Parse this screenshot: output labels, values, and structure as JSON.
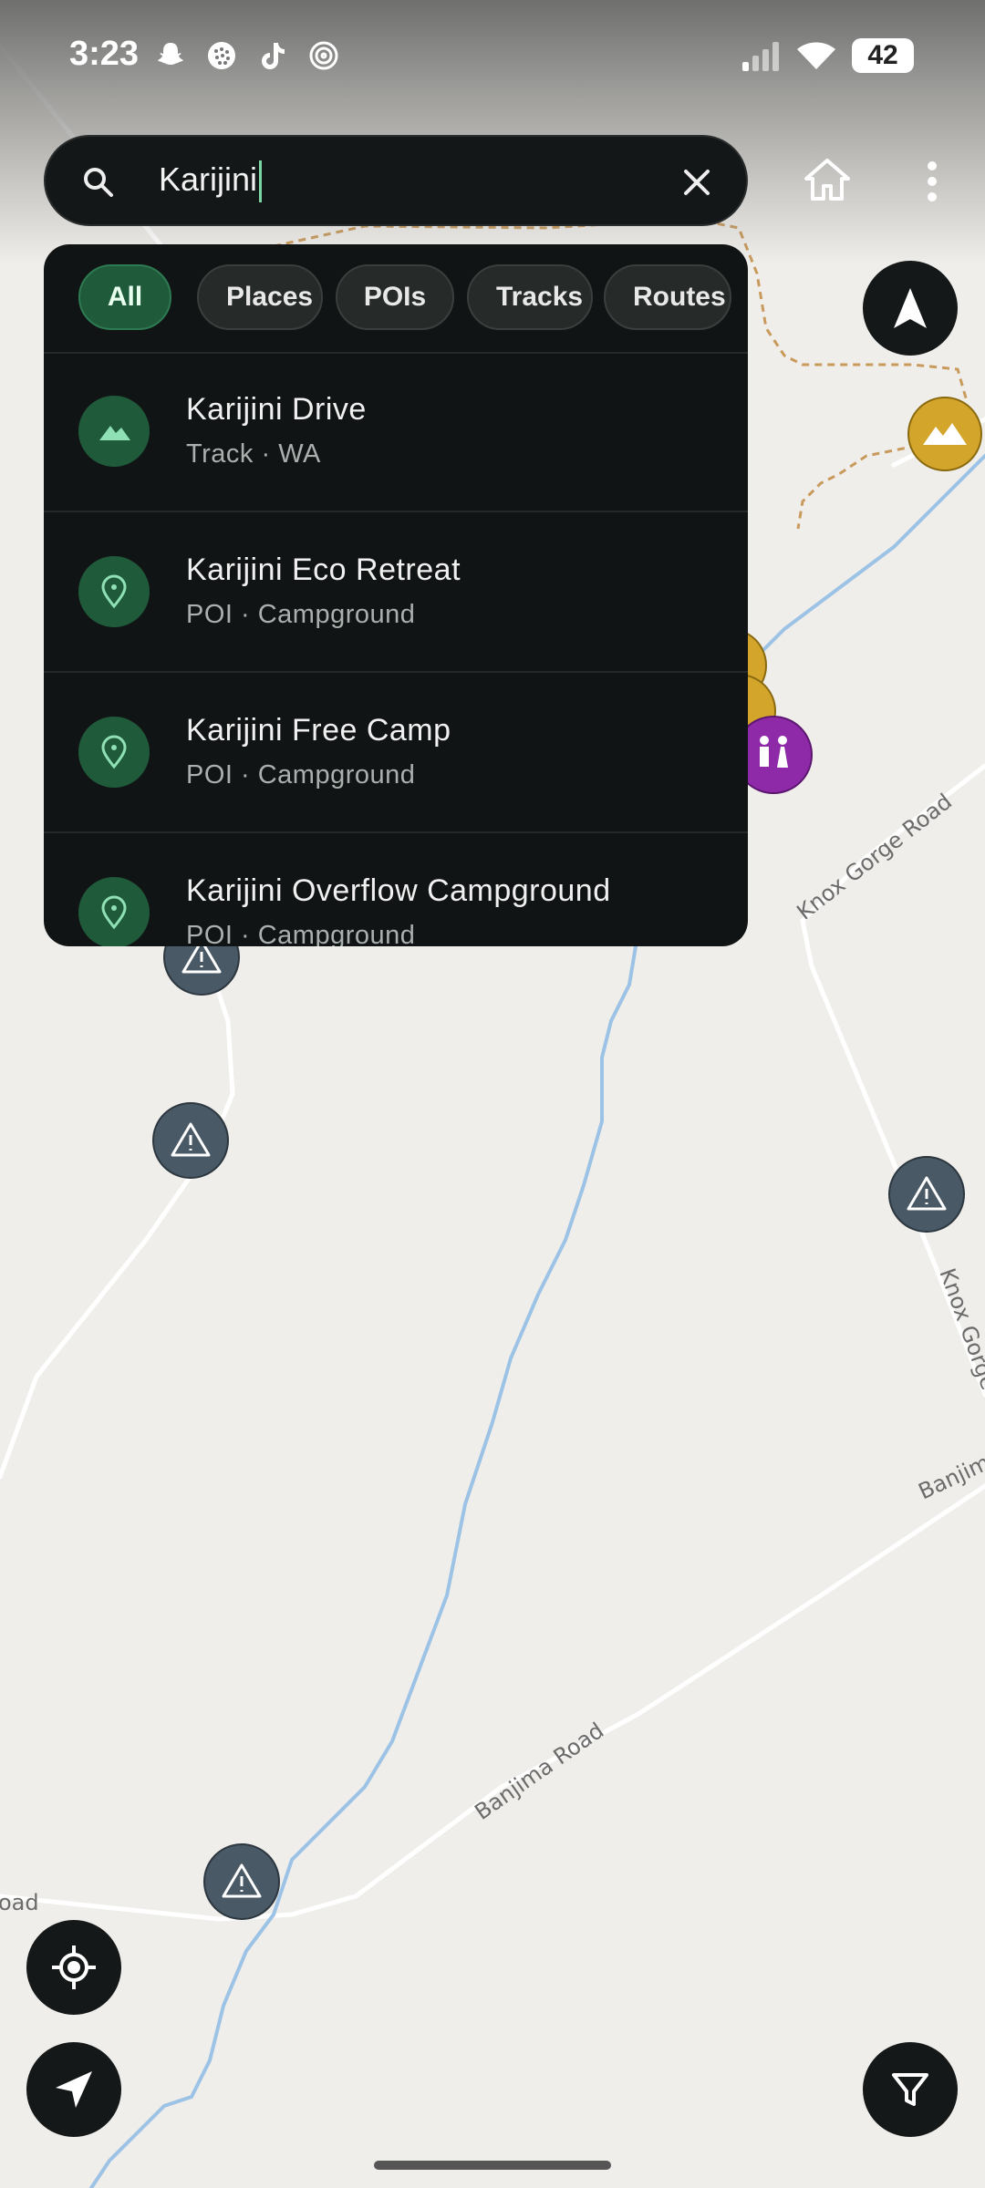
{
  "status_bar": {
    "time": "3:23",
    "battery": "42",
    "notification_icons": [
      "snapchat-icon",
      "web-icon",
      "tiktok-icon",
      "spiral-icon"
    ],
    "system_icons": [
      "cellular-signal-icon",
      "wifi-icon",
      "battery-icon"
    ]
  },
  "search": {
    "query": "Karijini",
    "icons": {
      "search": "search-icon",
      "clear": "close-icon"
    }
  },
  "top_actions": {
    "home": "home-icon",
    "menu": "more-vert-icon"
  },
  "filters": {
    "chips": [
      {
        "label": "All",
        "active": true
      },
      {
        "label": "Places",
        "active": false
      },
      {
        "label": "POIs",
        "active": false
      },
      {
        "label": "Tracks",
        "active": false
      },
      {
        "label": "Routes",
        "active": false
      }
    ]
  },
  "results": [
    {
      "title": "Karijini Drive",
      "subtitle": "Track · WA",
      "icon": "mountain-icon"
    },
    {
      "title": "Karijini Eco Retreat",
      "subtitle": "POI · Campground",
      "icon": "location-pin-icon"
    },
    {
      "title": "Karijini Free Camp",
      "subtitle": "POI · Campground",
      "icon": "location-pin-icon"
    },
    {
      "title": "Karijini Overflow Campground",
      "subtitle": "POI · Campground",
      "icon": "location-pin-icon"
    }
  ],
  "map": {
    "road_labels": [
      "Knox Gorge Road",
      "Knox Gorge R",
      "Banjima Road",
      "Banjim",
      "oad"
    ],
    "colors": {
      "background": "#f0eeea",
      "water": "#9cc3e6",
      "track": "#c89a5c",
      "warning_marker": "#4a5966",
      "campground_marker": "#d3a52a",
      "toilet_marker": "#8e2aa8"
    }
  },
  "controls": {
    "compass": "navigation-arrow-icon",
    "locate": "gps-target-icon",
    "navigate": "navigate-icon",
    "filter": "filter-funnel-icon"
  },
  "colors": {
    "accent": "#1f5a3a",
    "panel": "#111414",
    "text": "#f0f0f0"
  }
}
